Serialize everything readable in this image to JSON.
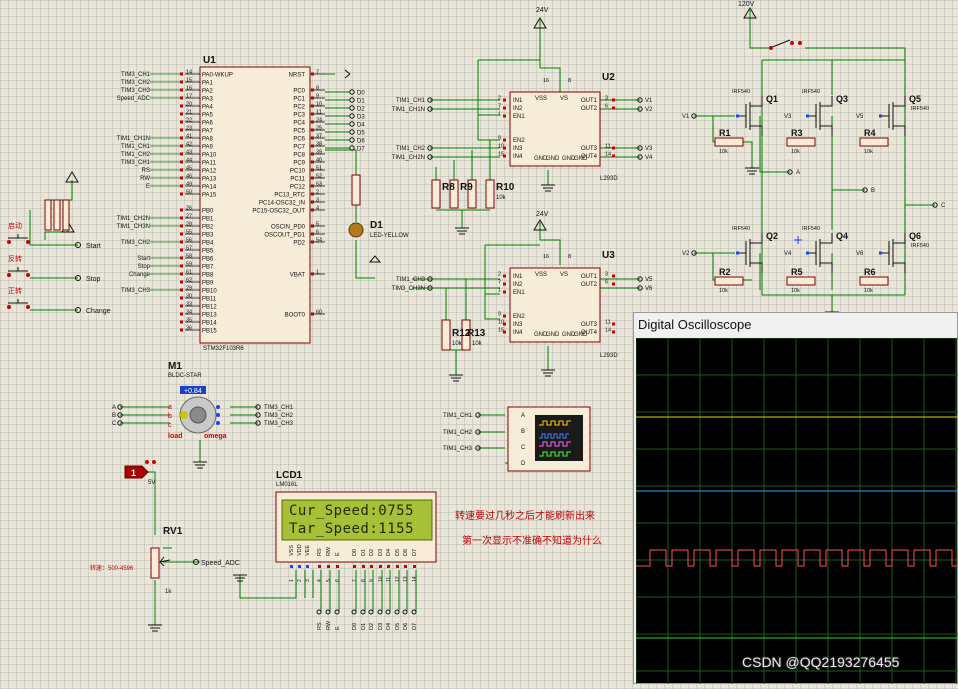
{
  "mcu": {
    "ref": "U1",
    "part": "STM32F103R6",
    "left_nets": [
      "TIM3_CH1",
      "TIM3_CH2",
      "TIM3_CH3",
      "Speed_ADC",
      "",
      "",
      "",
      "",
      "TIM1_CH1N",
      "TIM1_CH1",
      "TIM1_CH2",
      "TIM3_CH1",
      "RS",
      "RW",
      "E",
      "",
      "TIM3_CH1",
      "",
      "TIM1_CH2N",
      "TIM1_CH3N",
      "",
      "TIM3_CH2",
      "",
      "Start",
      "Stop",
      "Change",
      "",
      "TIM3_CH3",
      "",
      "",
      "",
      ""
    ],
    "left_pin_nums": [
      "14",
      "15",
      "16",
      "17",
      "20",
      "21",
      "22",
      "23",
      "41",
      "42",
      "43",
      "44",
      "45",
      "46",
      "49",
      "50",
      "",
      "26",
      "27",
      "28",
      "55",
      "56",
      "57",
      "58",
      "59",
      "61",
      "62",
      "29",
      "30",
      "33",
      "34",
      "35",
      "36"
    ],
    "left_pins": [
      "PA0-WKUP",
      "PA1",
      "PA2",
      "PA3",
      "PA4",
      "PA5",
      "PA6",
      "PA7",
      "PA8",
      "PA9",
      "PA10",
      "PA11",
      "PA12",
      "PA13",
      "PA14",
      "PA15",
      "",
      "PB0",
      "PB1",
      "PB2",
      "PB3",
      "PB4",
      "PB5",
      "PB6",
      "PB7",
      "PB8",
      "PB9",
      "PB10",
      "PB11",
      "PB12",
      "PB13",
      "PB14",
      "PB15"
    ],
    "right_pins": [
      "NRST",
      "",
      "PC0",
      "PC1",
      "PC2",
      "PC3",
      "PC4",
      "PC5",
      "PC6",
      "PC7",
      "PC8",
      "PC9",
      "PC10",
      "PC11",
      "PC12",
      "PC13_RTC",
      "PC14-OSC32_IN",
      "PC15-OSC32_OUT",
      "",
      "OSCIN_PD0",
      "OSCOUT_PD1",
      "PD2",
      "",
      "",
      "",
      "VBAT",
      "",
      "",
      "",
      "",
      "BOOT0"
    ],
    "right_pin_nums": [
      "7",
      "",
      "8",
      "9",
      "10",
      "11",
      "24",
      "25",
      "37",
      "38",
      "39",
      "40",
      "51",
      "52",
      "53",
      "2",
      "3",
      "4",
      "",
      "5",
      "6",
      "54",
      "",
      "",
      "",
      "1",
      "",
      "",
      "",
      "",
      "60"
    ],
    "right_nets": [
      "",
      "",
      "D0",
      "D1",
      "D2",
      "D3",
      "D4",
      "D5",
      "D6",
      "D7"
    ]
  },
  "buttons": {
    "labels": [
      "启动",
      "反转",
      "正转"
    ],
    "nets": [
      "Start",
      "Stop",
      "Change"
    ]
  },
  "led": {
    "ref": "D1",
    "part": "LED-YELLOW"
  },
  "drivers": [
    {
      "ref": "U2",
      "part": "L293D",
      "supply": "24V",
      "inputs": [
        "TIM1_CH1",
        "TIM1_CH1N",
        "TIM1_CH2",
        "TIM1_CH2N"
      ],
      "outputs": [
        "V1",
        "V2",
        "V3",
        "V4"
      ],
      "pins_left": [
        "IN1",
        "IN2",
        "EN1",
        "EN2",
        "IN3",
        "IN4"
      ],
      "pins_right": [
        "OUT1",
        "OUT2",
        "OUT3",
        "OUT4"
      ],
      "pins_bottom": [
        "VSS",
        "VS",
        "GND",
        "GND",
        "GND",
        "GND"
      ],
      "pin_nums_left": [
        "2",
        "7",
        "1",
        "9",
        "10",
        "15"
      ],
      "pin_nums_right": [
        "3",
        "6",
        "11",
        "14"
      ],
      "top_nums": [
        "16",
        "8"
      ]
    },
    {
      "ref": "U3",
      "part": "L293D",
      "supply": "24V",
      "inputs": [
        "TIM1_CH3",
        "TIM3_CH3N"
      ],
      "outputs": [
        "V5",
        "V6"
      ],
      "pins_left": [
        "IN1",
        "IN2",
        "EN1",
        "EN2",
        "IN3",
        "IN4"
      ],
      "pins_right": [
        "OUT1",
        "OUT2",
        "OUT3",
        "OUT4"
      ],
      "pins_bottom": [
        "VSS",
        "VS",
        "GND",
        "GND",
        "GND",
        "GND"
      ],
      "pin_nums_left": [
        "2",
        "7",
        "1",
        "9",
        "10",
        "15"
      ],
      "pin_nums_right": [
        "3",
        "6",
        "11",
        "14"
      ],
      "top_nums": [
        "16",
        "8"
      ]
    }
  ],
  "resistors_mid": [
    {
      "ref": "R8",
      "val": "10k"
    },
    {
      "ref": "R9",
      "val": "10k"
    },
    {
      "ref": "R10",
      "val": "10k"
    },
    {
      "ref": "R12",
      "val": "10k"
    },
    {
      "ref": "R13",
      "val": "10k"
    }
  ],
  "bridge": {
    "supply": "120V",
    "mosfets": [
      {
        "ref": "Q1",
        "part": "IRF540"
      },
      {
        "ref": "Q3",
        "part": "IRF540"
      },
      {
        "ref": "Q5",
        "part": "IRF540"
      },
      {
        "ref": "Q2",
        "part": "IRF540"
      },
      {
        "ref": "Q4",
        "part": "IRF540"
      },
      {
        "ref": "Q6",
        "part": "IRF540"
      }
    ],
    "gate_nets_top": [
      "V1",
      "V3",
      "V5"
    ],
    "gate_nets_bottom": [
      "V2",
      "V4",
      "V6"
    ],
    "resistors": [
      {
        "ref": "R1",
        "val": "10k"
      },
      {
        "ref": "R3",
        "val": "10k"
      },
      {
        "ref": "R4",
        "val": "10k"
      },
      {
        "ref": "R2",
        "val": "10k"
      },
      {
        "ref": "R5",
        "val": "10k"
      },
      {
        "ref": "R6",
        "val": "10k"
      }
    ],
    "phase_nets": [
      "A",
      "B",
      "C"
    ]
  },
  "motor": {
    "ref": "M1",
    "part": "BLDC-STAR",
    "readout": "+0.84",
    "inputs": [
      "A",
      "B",
      "C"
    ],
    "pins": [
      "a",
      "b",
      "c"
    ],
    "hall_nets": [
      "TIM3_CH1",
      "TIM3_CH2",
      "TIM3_CH3"
    ],
    "label_load": "load",
    "label_omega": "omega"
  },
  "probe": {
    "value": "1",
    "supply": "5V"
  },
  "pot": {
    "ref": "RV1",
    "val": "1k",
    "net": "Speed_ADC",
    "note": "转速：500-4596"
  },
  "scope": {
    "inputs": [
      "TIM1_CH1",
      "TIM1_CH2",
      "TIM1_CH3"
    ],
    "channels": [
      "A",
      "B",
      "C",
      "D"
    ]
  },
  "lcd": {
    "ref": "LCD1",
    "part": "LM016L",
    "line1": "Cur_Speed:0755",
    "line2": "Tar_Speed:1155",
    "pins": [
      "VSS",
      "VDD",
      "VEE",
      "RS",
      "RW",
      "E",
      "D0",
      "D1",
      "D2",
      "D3",
      "D4",
      "D5",
      "D6",
      "D7"
    ],
    "pin_nums": [
      "1",
      "2",
      "3",
      "4",
      "5",
      "6",
      "7",
      "8",
      "9",
      "10",
      "11",
      "12",
      "13",
      "14"
    ]
  },
  "notes": [
    "转速要过几秒之后才能刷新出来",
    "第一次显示不准确不知道为什么"
  ],
  "oscilloscope": {
    "title": "Digital Oscilloscope"
  },
  "watermark": "CSDN @QQ2193276455",
  "colors": {
    "wire": "#008000",
    "pin_red": "#cc0000",
    "chip_fill": "#f7ecd7",
    "chip_border": "#800000",
    "lcd_bg": "#a8c038",
    "osc_trace": "#ff4040",
    "osc_grid": "#1a4a1a"
  }
}
